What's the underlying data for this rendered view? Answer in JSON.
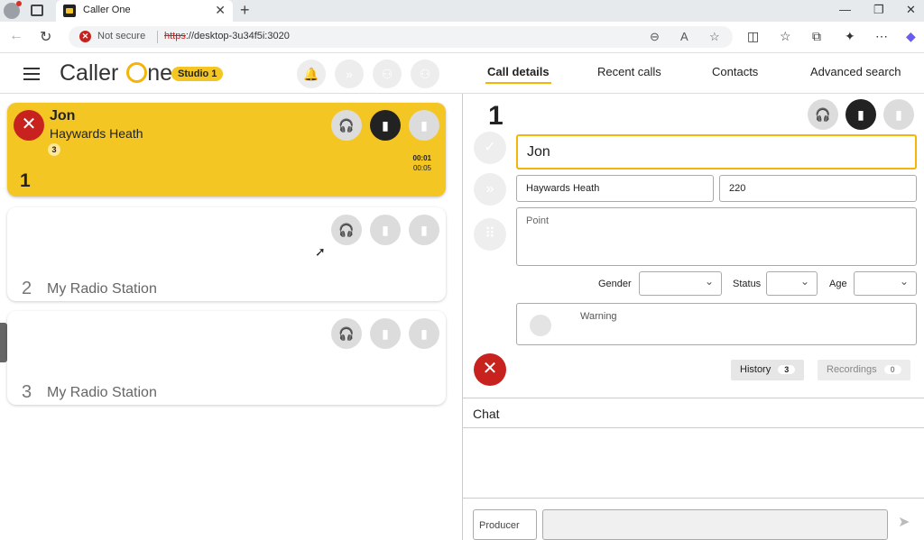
{
  "browser": {
    "tab_title": "Caller One",
    "security_label": "Not secure",
    "url_scheme": "https",
    "url_rest": "://desktop-3u34f5i:3020"
  },
  "header": {
    "logo_text": "Caller",
    "logo_suffix": "ne",
    "studio": "Studio 1",
    "nav": [
      "Call details",
      "Recent calls",
      "Contacts",
      "Advanced search"
    ]
  },
  "calls": [
    {
      "name": "Jon",
      "location": "Haywards Heath",
      "badge": "3",
      "number": "1",
      "time1": "00:01",
      "time2": "00:05"
    },
    {
      "number": "2",
      "station": "My Radio Station"
    },
    {
      "number": "3",
      "station": "My Radio Station"
    }
  ],
  "detail": {
    "number": "1",
    "name": "Jon",
    "location": "Haywards Heath",
    "code": "220",
    "point_placeholder": "Point",
    "gender_label": "Gender",
    "status_label": "Status",
    "age_label": "Age",
    "warning_placeholder": "Warning",
    "history_label": "History",
    "history_count": "3",
    "recordings_label": "Recordings",
    "recordings_count": "0"
  },
  "chat": {
    "title": "Chat",
    "producer_label": "Producer"
  }
}
